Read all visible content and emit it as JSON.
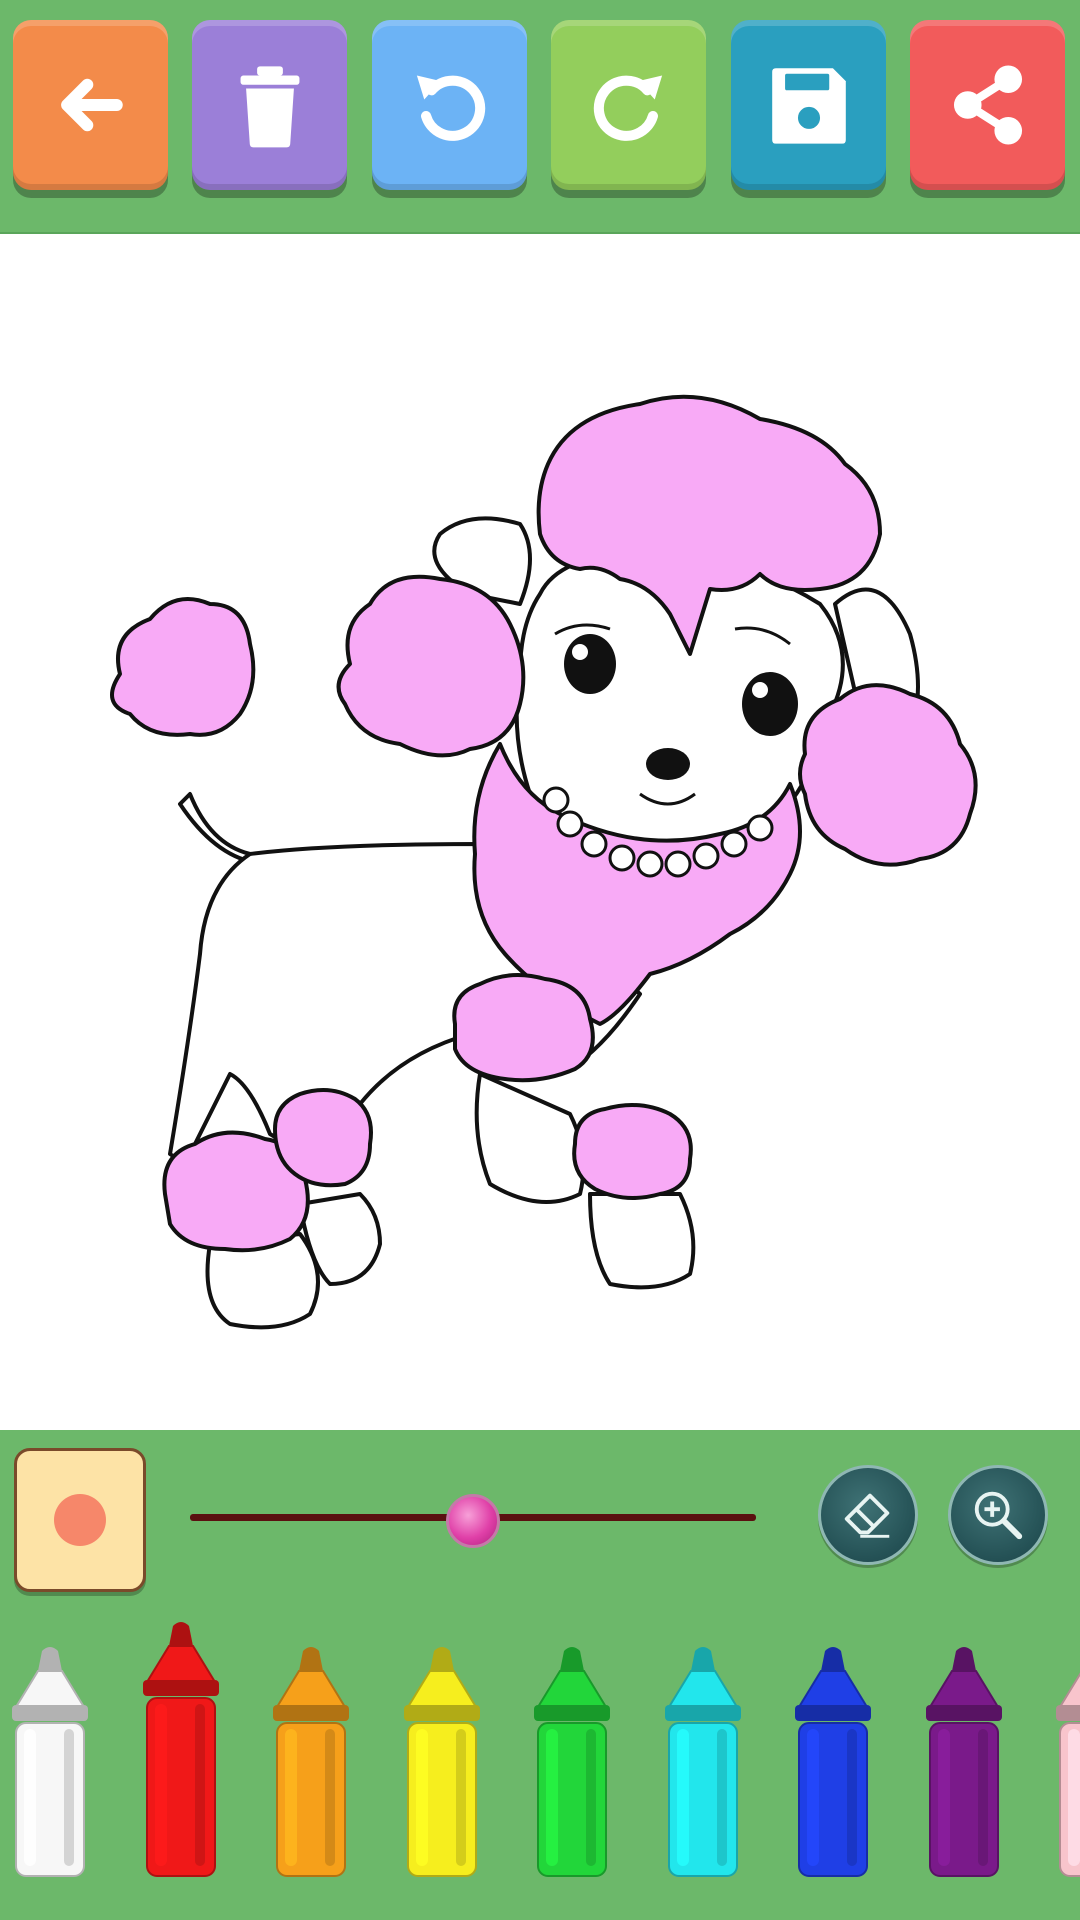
{
  "toolbar": {
    "buttons": [
      {
        "name": "back-button",
        "icon": "arrow-left-icon",
        "color": "#f38b4a"
      },
      {
        "name": "delete-button",
        "icon": "trash-icon",
        "color": "#9b7fd8"
      },
      {
        "name": "undo-button",
        "icon": "undo-icon",
        "color": "#6cb3f5"
      },
      {
        "name": "redo-button",
        "icon": "redo-icon",
        "color": "#93ce5c"
      },
      {
        "name": "save-button",
        "icon": "floppy-disk-icon",
        "color": "#2a9fbf"
      },
      {
        "name": "share-button",
        "icon": "share-icon",
        "color": "#f25b5b"
      }
    ]
  },
  "canvas": {
    "image": "poodle-coloring-page",
    "fill_color": "#f8aaf6",
    "line_color": "#111111"
  },
  "tools": {
    "brush_preview_color": "#f6876a",
    "brush_size_level": 0.5,
    "eraser_icon": "eraser-icon",
    "zoom_icon": "zoom-in-icon"
  },
  "palette": {
    "selected_index": 1,
    "colors": [
      {
        "name": "white",
        "color": "#f7f7f7"
      },
      {
        "name": "red",
        "color": "#f01818"
      },
      {
        "name": "orange",
        "color": "#f6a01a"
      },
      {
        "name": "yellow",
        "color": "#f6ee1e"
      },
      {
        "name": "green",
        "color": "#22d63a"
      },
      {
        "name": "cyan",
        "color": "#22e6ec"
      },
      {
        "name": "blue",
        "color": "#1f3fe6"
      },
      {
        "name": "purple",
        "color": "#7a1a8a"
      },
      {
        "name": "pink",
        "color": "#f8c4cc"
      }
    ]
  }
}
